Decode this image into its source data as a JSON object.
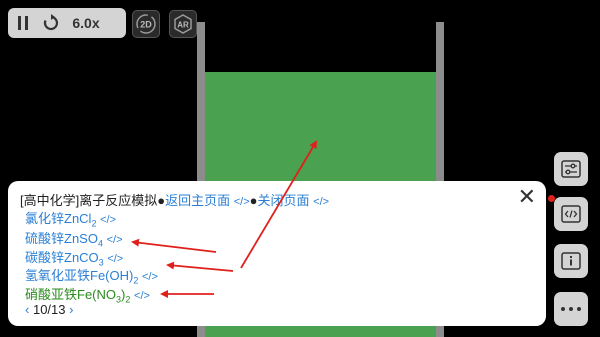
{
  "toolbar": {
    "speed_label": "6.0x",
    "mode_2d_label": "2D",
    "mode_ar_label": "AR"
  },
  "panel": {
    "title_prefix": "[高中化学]离子反应模拟",
    "home_link": "返回主页面",
    "close_link": "关闭页面",
    "code_icon": "</>",
    "bullet": "●",
    "close_symbol": "✕",
    "items": [
      {
        "name": "氯化锌ZnCl",
        "sub": "2"
      },
      {
        "name": "硫酸锌ZnSO",
        "sub": "4"
      },
      {
        "name": "碳酸锌ZnCO",
        "sub": "3"
      },
      {
        "name": "氢氧化亚铁Fe(OH)",
        "sub": "2"
      },
      {
        "name": "硝酸亚铁Fe(NO",
        "sub1": "3",
        "mid": ")",
        "sub2": "2"
      }
    ],
    "pager": {
      "prev": "‹",
      "current": "10/13",
      "next": "›"
    }
  },
  "colors": {
    "liquid": "#4aa14f",
    "link": "#2a7fd4",
    "selected_item": "#2b8a1f",
    "annotation_arrow": "#e0201b"
  },
  "icons": [
    "pause-icon",
    "restart-icon",
    "sliders-icon",
    "code-icon",
    "info-icon",
    "more-icon",
    "close-icon"
  ]
}
